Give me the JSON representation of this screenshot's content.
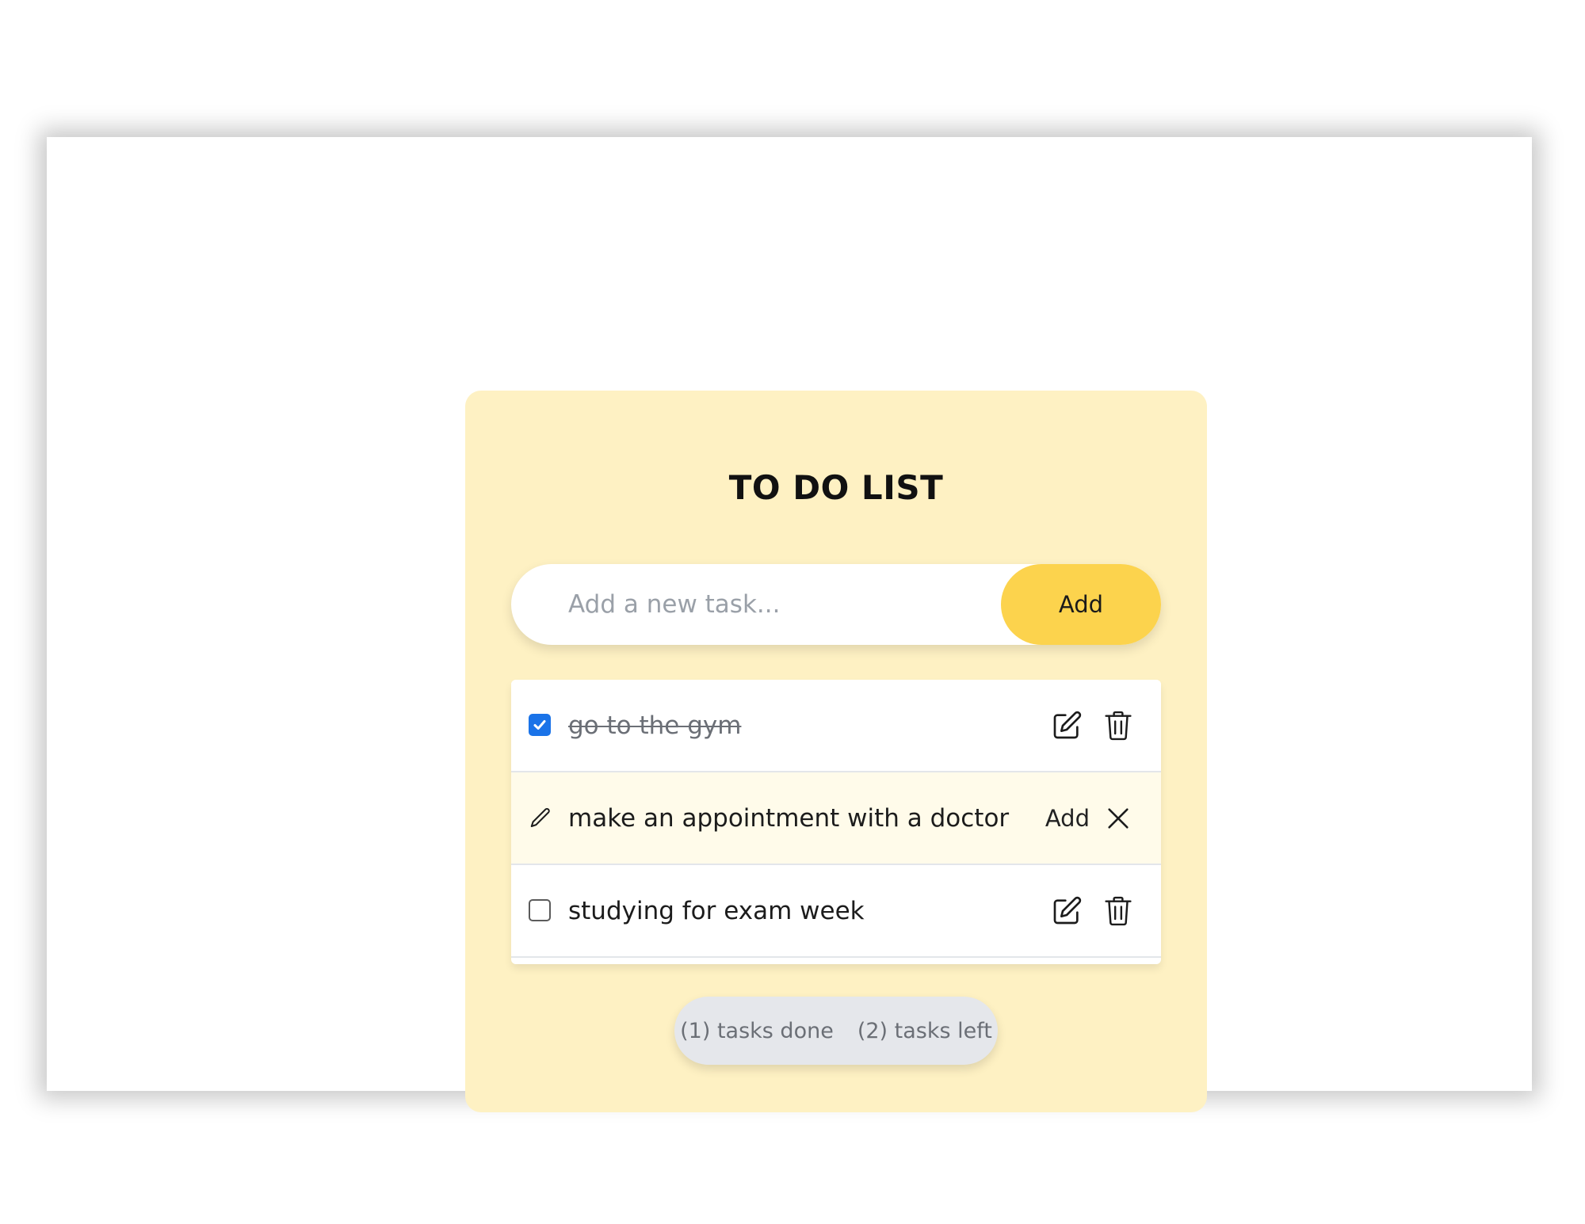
{
  "app": {
    "title": "TO DO LIST"
  },
  "form": {
    "placeholder": "Add a new task...",
    "add_label": "Add"
  },
  "tasks": [
    {
      "text": "go to the gym",
      "done": true,
      "mode": "view"
    },
    {
      "text": "make an appointment with a doctor",
      "mode": "edit",
      "confirm_label": "Add"
    },
    {
      "text": "studying for exam week",
      "done": false,
      "mode": "view"
    }
  ],
  "stats": {
    "done_text": "(1) tasks done",
    "left_text": "(2) tasks left"
  },
  "colors": {
    "card_background": "#fef1c3",
    "accent": "#fcd34d",
    "checkbox_checked": "#1a73e8",
    "editing_row": "#fffbea",
    "stats_background": "#e5e7eb"
  },
  "icons": {
    "checked": "checkbox-checked-icon",
    "unchecked": "checkbox-unchecked-icon",
    "edit": "pencil-square-icon",
    "delete": "trash-icon",
    "editing": "pencil-icon",
    "cancel": "close-icon"
  }
}
